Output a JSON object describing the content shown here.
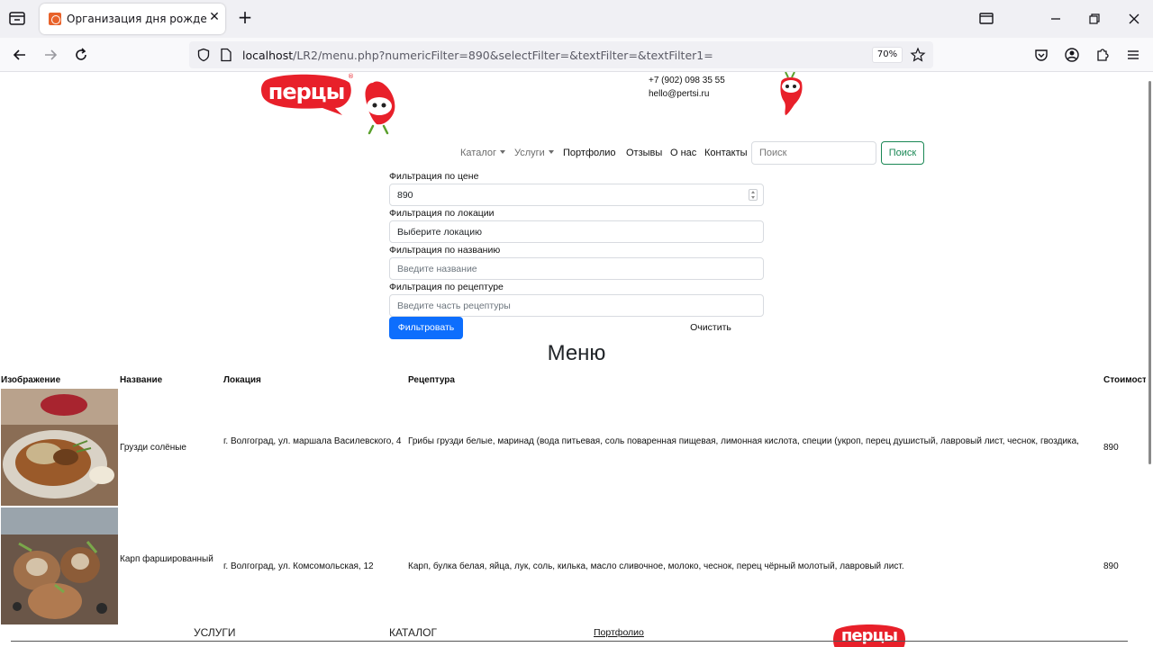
{
  "browser": {
    "tab_title": "Организация дня рождения и...",
    "url_host": "localhost",
    "url_rest": "/LR2/menu.php?numericFilter=890&selectFilter=&textFilter=&textFilter1=",
    "zoom": "70%"
  },
  "header": {
    "logo_text": "перцы",
    "phone": "+7 (902) 098 35 55",
    "email": "hello@pertsi.ru"
  },
  "nav": {
    "catalog": "Каталог",
    "services": "Услуги",
    "portfolio": "Портфолио",
    "reviews": "Отзывы",
    "about": "О нас",
    "contacts": "Контакты",
    "search_placeholder": "Поиск",
    "search_button": "Поиск"
  },
  "filters": {
    "price_label": "Фильтрация по цене",
    "price_value": "890",
    "location_label": "Фильтрация по локации",
    "location_value": "Выберите локацию",
    "name_label": "Фильтрация по названию",
    "name_placeholder": "Введите название",
    "recipe_label": "Фильтрация по рецептуре",
    "recipe_placeholder": "Введите часть рецептуры",
    "submit": "Фильтровать",
    "clear": "Очистить"
  },
  "menu": {
    "title": "Меню",
    "columns": [
      "Изображение",
      "Название",
      "Локация",
      "Рецептура",
      "Стоимость"
    ],
    "rows": [
      {
        "name": "Грузди солёные",
        "location": "г. Волгоград, ул. маршала Василевского, 4",
        "recipe": "Грибы грузди белые, маринад (вода питьевая, соль поваренная пищевая, лимонная кислота, специи (укроп, перец душистый, лавровый лист, чеснок, гвоздика,",
        "price": "890"
      },
      {
        "name": "Карп фаршированный",
        "location": "г. Волгоград, ул. Комсомольская, 12",
        "recipe": "Карп, булка белая, яйца, лук, соль, килька, масло сливочное, молоко, чеснок, перец чёрный молотый, лавровый лист.",
        "price": "890"
      }
    ]
  },
  "footer": {
    "services": "УСЛУГИ",
    "catalog": "КАТАЛОГ",
    "portfolio": "Портфолио",
    "logo_text": "перцы"
  },
  "colors": {
    "brand_red": "#e8202a",
    "primary_blue": "#0d6efd",
    "search_green": "#198754"
  }
}
